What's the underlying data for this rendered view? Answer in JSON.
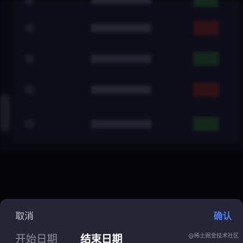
{
  "sheet": {
    "cancel_label": "取消",
    "confirm_label": "确认",
    "tabs": [
      {
        "label": "开始日期",
        "active": false
      },
      {
        "label": "结束日期",
        "active": true
      }
    ]
  },
  "watermark": "@稀土掘金技术社区",
  "colors": {
    "accent": "#4a7cf6",
    "sheet_bg": "#252535",
    "page_bg": "#08080f",
    "tag_green": "#1e3d28",
    "tag_red": "#4a1c23"
  },
  "background_rows": [
    {
      "tag_color": "green"
    },
    {
      "tag_color": "red"
    },
    {
      "tag_color": "green"
    },
    {
      "tag_color": "red"
    },
    {
      "tag_color": "green"
    }
  ]
}
